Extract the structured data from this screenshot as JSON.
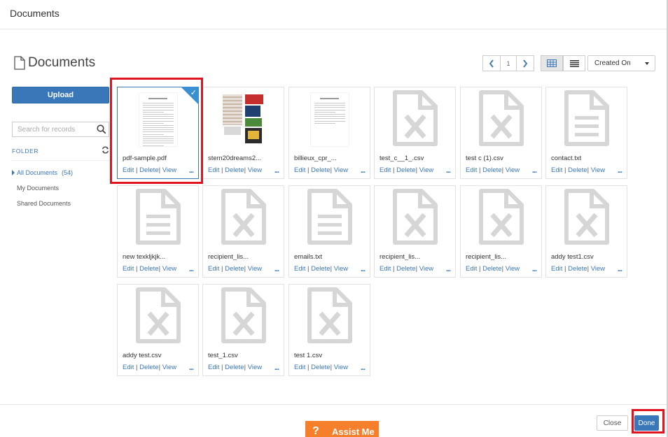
{
  "modal": {
    "title": "Documents"
  },
  "header": {
    "title": "Documents"
  },
  "pagination": {
    "page": "1"
  },
  "sort": {
    "selected": "Created On"
  },
  "sidebar": {
    "upload_label": "Upload",
    "search_placeholder": "Search for records",
    "folder_heading": "FOLDER",
    "folders": [
      {
        "label": "All Documents",
        "count": "(54)"
      },
      {
        "label": "My Documents"
      },
      {
        "label": "Shared Documents"
      }
    ]
  },
  "actions": {
    "edit": "Edit",
    "delete": "Delete",
    "view": "View",
    "more": "..."
  },
  "documents": [
    {
      "name": "pdf-sample.pdf",
      "thumb": "pdf-preview",
      "selected": true
    },
    {
      "name": "stem20dreams2...",
      "thumb": "image-collage"
    },
    {
      "name": "billieux_cpr_...",
      "thumb": "doc-preview"
    },
    {
      "name": "test_c__1_.csv",
      "thumb": "csv-icon"
    },
    {
      "name": "test c (1).csv",
      "thumb": "csv-icon"
    },
    {
      "name": "contact.txt",
      "thumb": "txt-icon"
    },
    {
      "name": "new texkljkjk...",
      "thumb": "txt-icon"
    },
    {
      "name": "recipient_lis...",
      "thumb": "csv-icon"
    },
    {
      "name": "emails.txt",
      "thumb": "txt-icon"
    },
    {
      "name": "recipient_lis...",
      "thumb": "csv-icon"
    },
    {
      "name": "recipient_lis...",
      "thumb": "csv-icon"
    },
    {
      "name": "addy test1.csv",
      "thumb": "csv-icon"
    },
    {
      "name": "addy test.csv",
      "thumb": "csv-icon"
    },
    {
      "name": "test_1.csv",
      "thumb": "csv-icon"
    },
    {
      "name": "test 1.csv",
      "thumb": "csv-icon"
    }
  ],
  "footer": {
    "assist_label": "Assist Me",
    "assist_icon": "?",
    "close_label": "Close",
    "done_label": "Done"
  },
  "colors": {
    "primary": "#3a77b8",
    "assist": "#f57f2a",
    "highlight": "#e0141e"
  }
}
